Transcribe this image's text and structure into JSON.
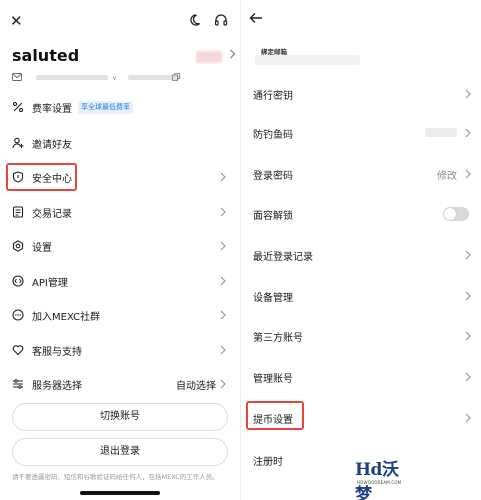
{
  "left": {
    "username": "saluted",
    "account_small": "∨",
    "menu": [
      {
        "id": "fees",
        "label": "费率设置",
        "badge": "享全球最低费率",
        "icon": "percent-icon"
      },
      {
        "id": "invite",
        "label": "邀请好友",
        "icon": "add-person-icon"
      },
      {
        "id": "security",
        "label": "安全中心",
        "icon": "shield-icon"
      },
      {
        "id": "records",
        "label": "交易记录",
        "icon": "document-icon"
      },
      {
        "id": "settings",
        "label": "设置",
        "icon": "gear-icon"
      },
      {
        "id": "api",
        "label": "API管理",
        "icon": "api-icon"
      },
      {
        "id": "community",
        "label": "加入MEXC社群",
        "icon": "chat-icon"
      },
      {
        "id": "support",
        "label": "客服与支持",
        "icon": "heart-icon"
      },
      {
        "id": "server",
        "label": "服务器选择",
        "value": "自动选择",
        "icon": "sliders-icon"
      }
    ],
    "switch_account": "切换账号",
    "logout": "退出登录",
    "footer_note": "请不要透露密码、短信和谷歌验证码给任何人，包括MEXC的工作人员。"
  },
  "right": {
    "email_label": "绑定邮箱",
    "rows": [
      {
        "id": "passkey",
        "label": "通行密钥"
      },
      {
        "id": "antiphishing",
        "label": "防钓鱼码"
      },
      {
        "id": "login-password",
        "label": "登录密码",
        "value": "修改"
      },
      {
        "id": "face-unlock",
        "label": "面容解锁",
        "toggle": false
      },
      {
        "id": "recent-logins",
        "label": "最近登录记录"
      },
      {
        "id": "devices",
        "label": "设备管理"
      },
      {
        "id": "third-party",
        "label": "第三方账号"
      },
      {
        "id": "manage-accounts",
        "label": "管理账号"
      },
      {
        "id": "withdraw-settings",
        "label": "提币设置"
      },
      {
        "id": "deregister",
        "label": "注册时"
      }
    ]
  },
  "watermark": {
    "main": "Hd沃梦",
    "sub": "HDWOODREAM.COM"
  },
  "colors": {
    "highlight": "#e8453c",
    "badge": "#2a7fde",
    "watermark": "#1d3f86"
  }
}
